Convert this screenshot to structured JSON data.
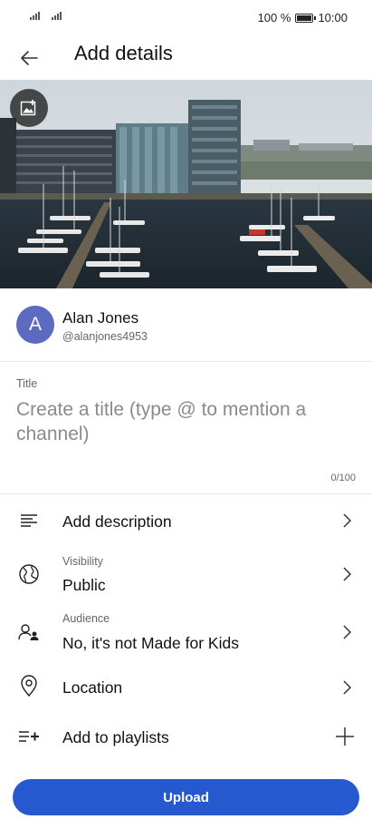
{
  "status_bar": {
    "battery_text": "100 %",
    "time": "10:00"
  },
  "header": {
    "title": "Add details",
    "back_icon": "arrow-left-icon"
  },
  "thumbnail": {
    "change_icon": "add-image-icon"
  },
  "owner": {
    "avatar_letter": "A",
    "avatar_color": "#5c6bc0",
    "name": "Alan Jones",
    "handle": "@alanjones4953"
  },
  "title_field": {
    "label": "Title",
    "placeholder": "Create a title (type @ to mention a channel)",
    "value": "",
    "counter": "0/100"
  },
  "options": {
    "description": {
      "label": "Add description"
    },
    "visibility": {
      "caption": "Visibility",
      "value": "Public"
    },
    "audience": {
      "caption": "Audience",
      "value": "No, it's not Made for Kids"
    },
    "location": {
      "label": "Location"
    },
    "playlists": {
      "label": "Add to playlists"
    }
  },
  "upload": {
    "label": "Upload",
    "color": "#2659cf"
  }
}
